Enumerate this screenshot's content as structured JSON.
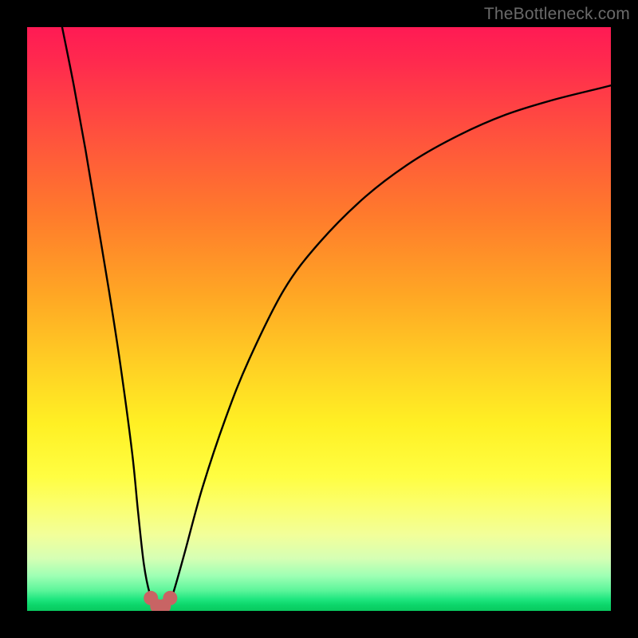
{
  "watermark": {
    "text": "TheBottleneck.com"
  },
  "colors": {
    "frame": "#000000",
    "gradient_top": "#ff1a54",
    "gradient_mid": "#ffd024",
    "gradient_bottom": "#09c95f",
    "curve": "#000000",
    "marker": "#c86464"
  },
  "chart_data": {
    "type": "line",
    "title": "",
    "xlabel": "",
    "ylabel": "",
    "xlim": [
      0,
      100
    ],
    "ylim": [
      0,
      100
    ],
    "series": [
      {
        "name": "bottleneck-curve",
        "x": [
          6,
          8,
          10,
          12,
          14,
          16,
          18,
          19,
          20,
          21,
          22,
          23,
          24,
          25,
          27,
          30,
          34,
          38,
          44,
          50,
          58,
          66,
          74,
          82,
          90,
          98,
          100
        ],
        "values": [
          100,
          90,
          79,
          67,
          55,
          42,
          27,
          17,
          8,
          3,
          1,
          0.5,
          1,
          3,
          10,
          21,
          33,
          43,
          55,
          63,
          71,
          77,
          81.5,
          85,
          87.5,
          89.5,
          90
        ]
      }
    ],
    "markers": [
      {
        "name": "valley-left",
        "x": 21.2,
        "y": 2.2
      },
      {
        "name": "valley-mid-l",
        "x": 22.3,
        "y": 0.8
      },
      {
        "name": "valley-mid-r",
        "x": 23.4,
        "y": 0.8
      },
      {
        "name": "valley-right",
        "x": 24.5,
        "y": 2.2
      }
    ],
    "legend": false,
    "grid": false
  }
}
